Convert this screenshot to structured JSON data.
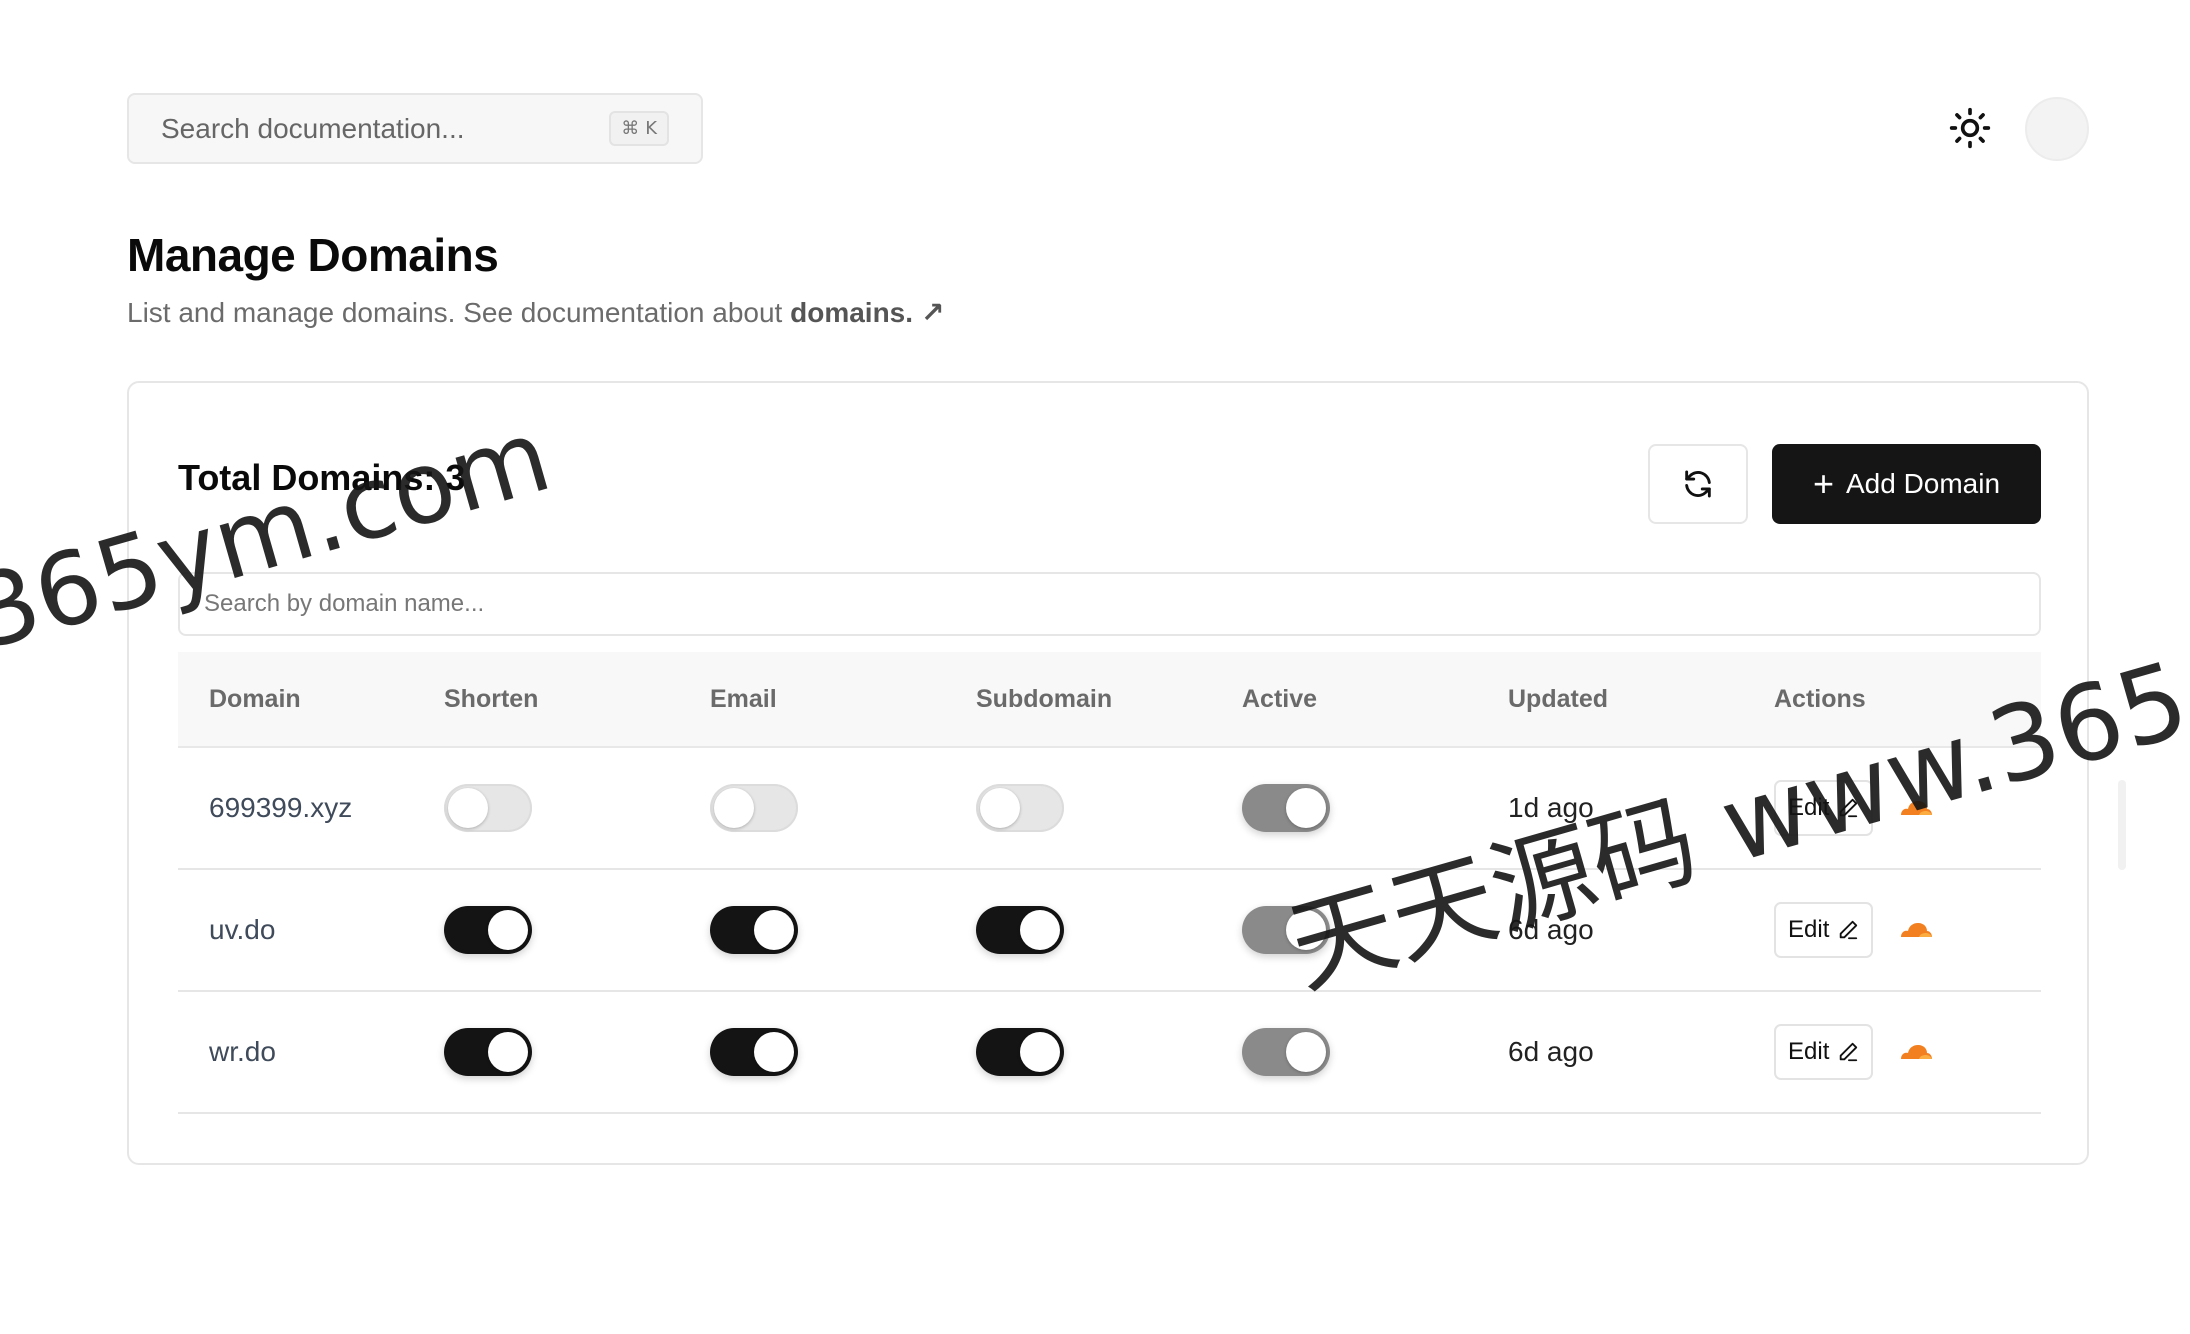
{
  "topbar": {
    "search_placeholder": "Search documentation...",
    "shortcut_symbol": "⌘",
    "shortcut_key": "K"
  },
  "page": {
    "title": "Manage Domains",
    "description": "List and manage domains. See documentation about ",
    "doc_link": "domains.",
    "doc_link_icon": "↗"
  },
  "card": {
    "total_label": "Total Domains: 3",
    "add_button": "Add Domain",
    "add_button_icon": "+",
    "search_placeholder": "Search by domain name..."
  },
  "table": {
    "headers": [
      "Domain",
      "Shorten",
      "Email",
      "Subdomain",
      "Active",
      "Updated",
      "Actions"
    ],
    "rows": [
      {
        "domain": "699399.xyz",
        "shorten": false,
        "email": false,
        "subdomain": false,
        "active": true,
        "updated": "1d ago",
        "edit": "Edit"
      },
      {
        "domain": "uv.do",
        "shorten": true,
        "email": true,
        "subdomain": true,
        "active": true,
        "updated": "6d ago",
        "edit": "Edit"
      },
      {
        "domain": "wr.do",
        "shorten": true,
        "email": true,
        "subdomain": true,
        "active": true,
        "updated": "6d ago",
        "edit": "Edit"
      }
    ]
  },
  "icons": {
    "theme": "sun-icon",
    "refresh": "refresh-icon",
    "edit": "pencil-icon",
    "provider": "cloudflare-icon",
    "cloudflare_color": "#f38020"
  },
  "watermarks": [
    "365ym.com",
    "天天源码 www.365"
  ]
}
